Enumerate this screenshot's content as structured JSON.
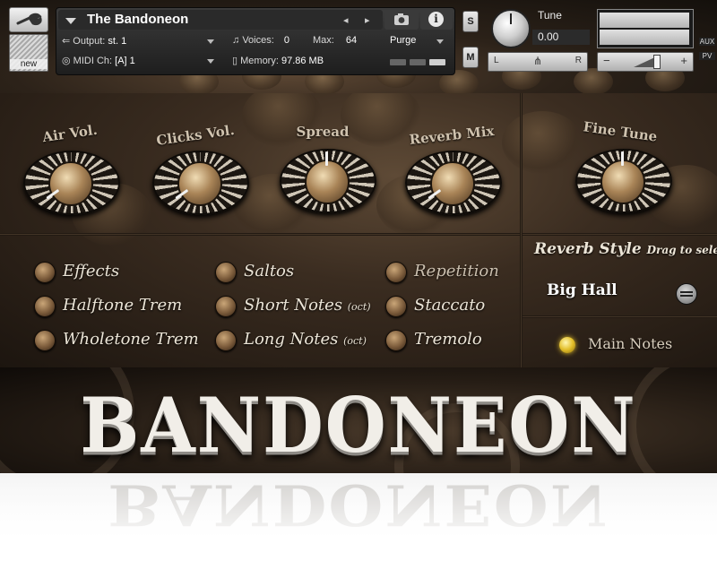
{
  "header": {
    "instrument_name": "The Bandoneon",
    "new_label": "new",
    "nav_prev": "◂",
    "nav_next": "▸",
    "info_glyph": "i",
    "output_label": "Output:",
    "output_value": "st. 1",
    "voices_label": "Voices:",
    "voices_value": "0",
    "max_label": "Max:",
    "max_value": "64",
    "purge_label": "Purge",
    "midi_label": "MIDI Ch:",
    "midi_value": "[A]  1",
    "memory_label": "Memory:",
    "memory_value": "97.86 MB",
    "solo_label": "S",
    "mute_label": "M",
    "tune_label": "Tune",
    "tune_value": "0.00",
    "pan_left": "L",
    "pan_right": "R",
    "vol_minus": "−",
    "vol_plus": "+",
    "aux_label": "AUX",
    "pv_label": "PV",
    "icons": [
      "wrench-icon",
      "camera-icon",
      "info-icon",
      "output-icon",
      "midi-icon",
      "voices-icon",
      "memory-icon"
    ]
  },
  "knobs": [
    {
      "id": "air-vol",
      "label": "Air Vol.",
      "level": 0.0
    },
    {
      "id": "clicks-vol",
      "label": "Clicks Vol.",
      "level": 0.0
    },
    {
      "id": "spread",
      "label": "Spread",
      "level": 0.5
    },
    {
      "id": "reverb-mix",
      "label": "Reverb Mix",
      "level": 0.0
    },
    {
      "id": "fine-tune",
      "label": "Fine Tune",
      "level": 0.5
    }
  ],
  "options": {
    "col1": [
      {
        "label": "Effects",
        "suffix": ""
      },
      {
        "label": "Halftone Trem",
        "suffix": ""
      },
      {
        "label": "Wholetone Trem",
        "suffix": ""
      }
    ],
    "col2": [
      {
        "label": "Saltos",
        "suffix": ""
      },
      {
        "label": "Short Notes",
        "suffix": "(oct)"
      },
      {
        "label": "Long Notes",
        "suffix": "(oct)"
      }
    ],
    "col3": [
      {
        "label": "Repetition",
        "suffix": ""
      },
      {
        "label": "Staccato",
        "suffix": ""
      },
      {
        "label": "Tremolo",
        "suffix": ""
      }
    ]
  },
  "reverb": {
    "title": "Reverb Style",
    "hint": "Drag to select",
    "value": "Big Hall"
  },
  "main_notes": {
    "label": "Main Notes",
    "active": true,
    "led_color": "#e3bf2a"
  },
  "logo": {
    "text": "BANDONEON"
  }
}
